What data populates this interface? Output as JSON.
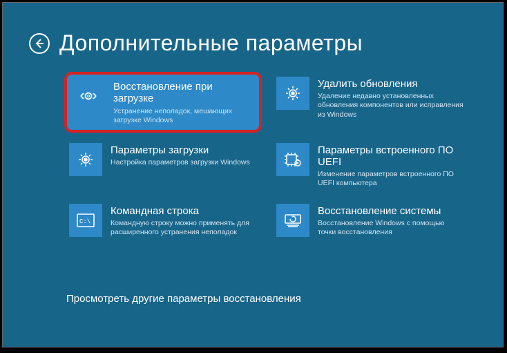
{
  "header": {
    "title": "Дополнительные параметры"
  },
  "tiles": [
    {
      "title": "Восстановление при загрузке",
      "desc": "Устранение неполадок, мешающих загрузке Windows",
      "icon": "wrench-code-icon",
      "selected": true
    },
    {
      "title": "Удалить обновления",
      "desc": "Удаление недавно установленных обновления компонентов или исправления из Windows",
      "icon": "gear-icon",
      "selected": false
    },
    {
      "title": "Параметры загрузки",
      "desc": "Настройка параметров загрузки Windows",
      "icon": "gear-icon",
      "selected": false
    },
    {
      "title": "Параметры встроенного ПО UEFI",
      "desc": "Изменение параметров встроенного ПО UEFI компьютера",
      "icon": "chip-gear-icon",
      "selected": false
    },
    {
      "title": "Командная строка",
      "desc": "Командную строку можно применять для расширенного устранения неполадок",
      "icon": "terminal-icon",
      "selected": false
    },
    {
      "title": "Восстановление системы",
      "desc": "Восстановление Windows с помощью точки восстановления",
      "icon": "restore-icon",
      "selected": false
    }
  ],
  "more": {
    "label": "Просмотреть другие параметры восстановления"
  },
  "colors": {
    "bg": "#18658a",
    "tile_icon_bg": "#2d89c7",
    "highlight": "#d62222"
  }
}
